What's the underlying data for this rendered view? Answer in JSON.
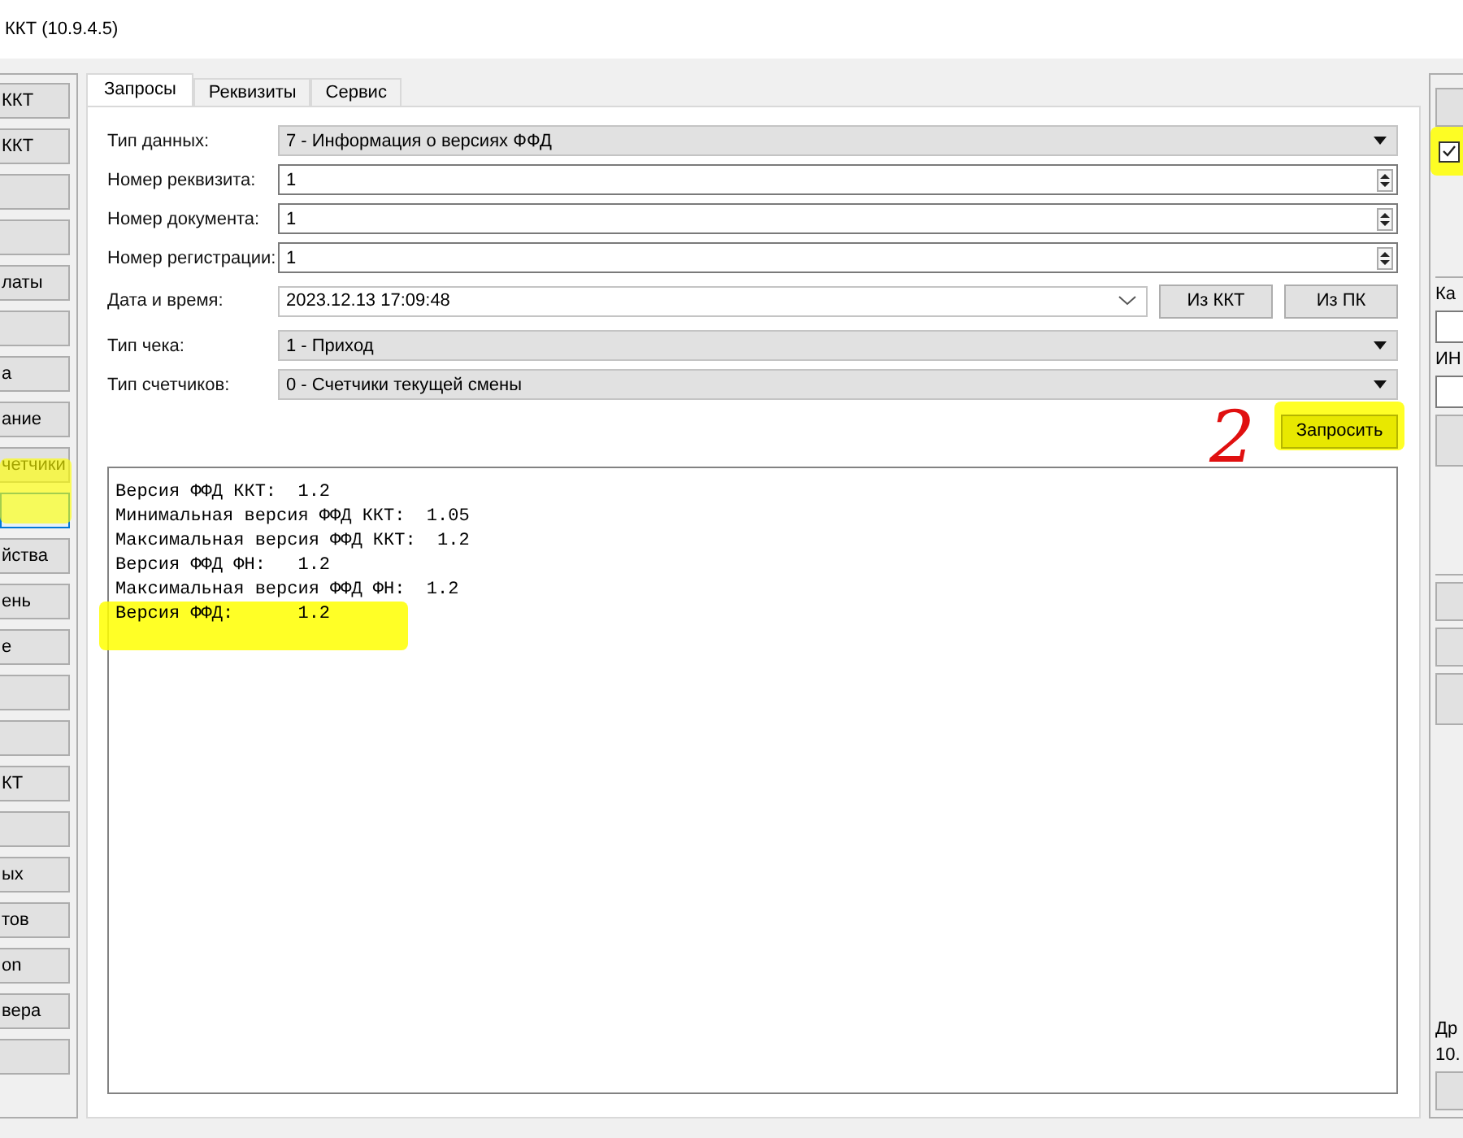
{
  "window": {
    "title": "ККТ (10.9.4.5)"
  },
  "left_buttons": [
    {
      "label": "ККТ",
      "selected": false
    },
    {
      "label": "ККТ",
      "selected": false
    },
    {
      "selected": false
    },
    {
      "selected": false
    },
    {
      "label": "латы",
      "selected": false
    },
    {
      "selected": false
    },
    {
      "label": "а",
      "selected": false
    },
    {
      "label": "ание",
      "selected": false
    },
    {
      "label": "четчики",
      "selected": false
    },
    {
      "selected": true
    },
    {
      "label": "йства",
      "selected": false
    },
    {
      "label": "ень",
      "selected": false
    },
    {
      "label": "е",
      "selected": false
    },
    {
      "selected": false
    },
    {
      "selected": false
    },
    {
      "label": "КТ",
      "selected": false
    },
    {
      "selected": false
    },
    {
      "label": "ых",
      "selected": false
    },
    {
      "label": "тов",
      "selected": false
    },
    {
      "label": "on",
      "selected": false
    },
    {
      "label": "вера",
      "selected": false
    },
    {
      "selected": false
    }
  ],
  "tabs": [
    {
      "label": "Запросы",
      "selected": true
    },
    {
      "label": "Реквизиты",
      "selected": false
    },
    {
      "label": "Сервис",
      "selected": false
    }
  ],
  "form": [
    {
      "kind": "combo",
      "label": "Тип данных:",
      "value": "7 - Информация о версиях ФФД"
    },
    {
      "kind": "spin",
      "label": "Номер реквизита:",
      "value": "1"
    },
    {
      "kind": "spin",
      "label": "Номер документа:",
      "value": "1"
    },
    {
      "kind": "spin",
      "label": "Номер регистрации:",
      "value": "1"
    },
    {
      "kind": "date",
      "label": "Дата и время:",
      "value": "2023.12.13 17:09:48",
      "buttons": [
        "Из ККТ",
        "Из ПК"
      ]
    },
    {
      "kind": "combo",
      "label": "Тип чека:",
      "value": "1 - Приход"
    },
    {
      "kind": "combo",
      "label": "Тип счетчиков:",
      "value": "0 - Счетчики текущей смены"
    }
  ],
  "request_button": "Запросить",
  "annotation": "2",
  "output": [
    "Версия ФФД ККТ:  1.2",
    "Минимальная версия ФФД ККТ:  1.05",
    "Максимальная версия ФФД ККТ:  1.2",
    "Версия ФФД ФН:   1.2",
    "Максимальная версия ФФД ФН:  1.2",
    "Версия ФФД:      1.2"
  ],
  "right_panel": [
    {
      "kind": "button"
    },
    {
      "kind": "checkbox",
      "checked": true
    },
    {
      "kind": "spacer"
    },
    {
      "kind": "label",
      "text": "Ка"
    },
    {
      "kind": "field"
    },
    {
      "kind": "label",
      "text": "ИН"
    },
    {
      "kind": "field"
    },
    {
      "kind": "bigbutton"
    },
    {
      "kind": "spacer"
    },
    {
      "kind": "button"
    },
    {
      "kind": "button"
    },
    {
      "kind": "bigbutton"
    },
    {
      "kind": "fill"
    },
    {
      "kind": "label",
      "text": "Др"
    },
    {
      "kind": "label",
      "text": "10."
    },
    {
      "kind": "button"
    }
  ]
}
